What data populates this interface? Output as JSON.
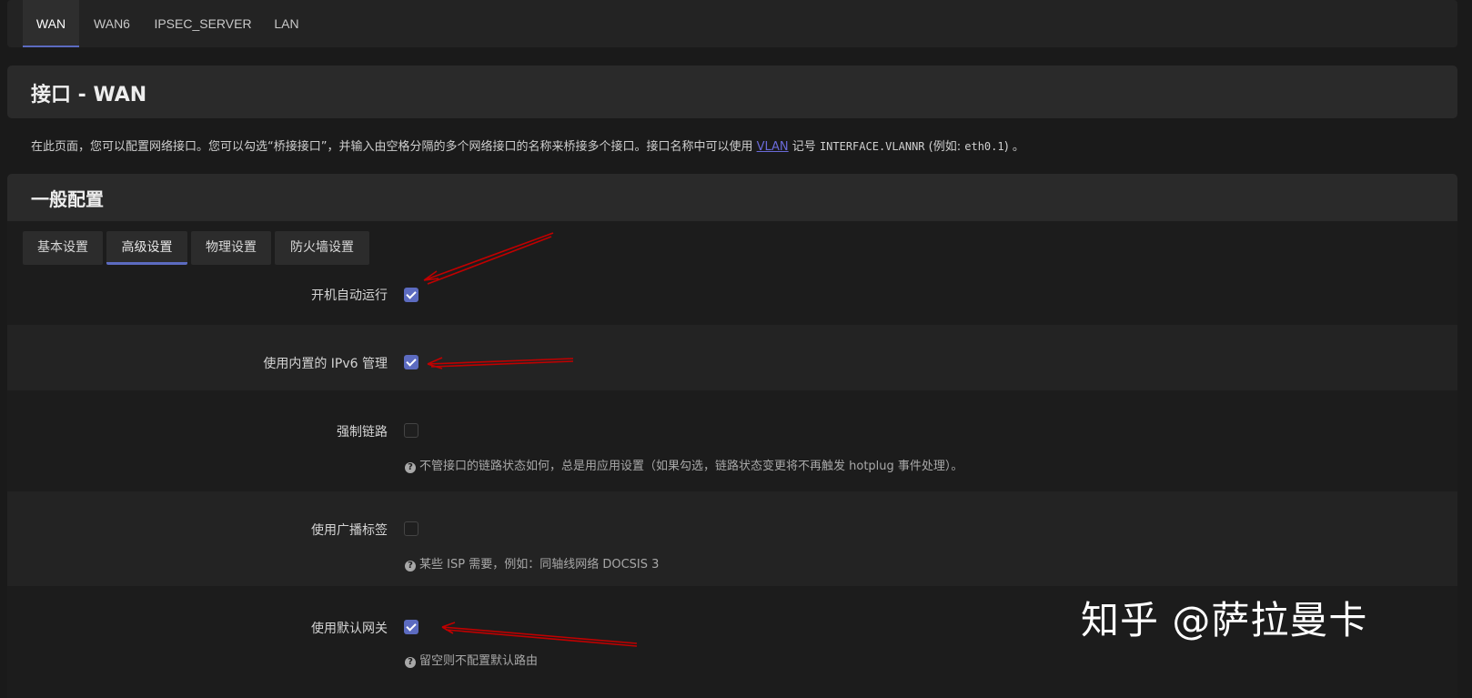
{
  "top_tabs": [
    "WAN",
    "WAN6",
    "IPSEC_SERVER",
    "LAN"
  ],
  "page_title": "接口 - WAN",
  "description": {
    "before_link": "在此页面，您可以配置网络接口。您可以勾选“桥接接口”，并输入由空格分隔的多个网络接口的名称来桥接多个接口。接口名称中可以使用 ",
    "link": "VLAN",
    "middle": " 记号 ",
    "code1": "INTERFACE.VLANNR",
    "middle2": " (例如: ",
    "code2": "eth0.1",
    "after": ") 。"
  },
  "section_title": "一般配置",
  "sub_tabs": [
    "基本设置",
    "高级设置",
    "物理设置",
    "防火墙设置"
  ],
  "options": [
    {
      "label": "开机自动运行",
      "checked": true,
      "hint": ""
    },
    {
      "label": "使用内置的 IPv6 管理",
      "checked": true,
      "hint": ""
    },
    {
      "label": "强制链路",
      "checked": false,
      "hint": "不管接口的链路状态如何，总是用应用设置（如果勾选，链路状态变更将不再触发 hotplug 事件处理）。"
    },
    {
      "label": "使用广播标签",
      "checked": false,
      "hint": "某些 ISP 需要，例如：同轴线网络 DOCSIS 3"
    },
    {
      "label": "使用默认网关",
      "checked": true,
      "hint": "留空则不配置默认路由"
    }
  ],
  "hint_icon": "?",
  "watermark": "知乎 @萨拉曼卡",
  "colors": {
    "accent": "#5c6bc0",
    "annotation_arrow": "#c00000",
    "link": "#6a6ad8"
  }
}
